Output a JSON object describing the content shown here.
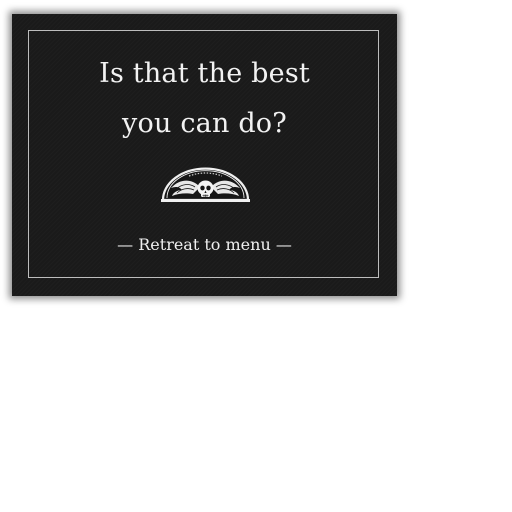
{
  "dialog": {
    "message_line1": "Is that the best",
    "message_line2": "you can do?",
    "emblem": "winged-skull-icon",
    "menu_link": "— Retreat to menu —"
  },
  "colors": {
    "panel": "#1a1a1a",
    "text": "#f2f2f2",
    "frame_line": "#bdbdbd",
    "page_background": "#ffffff"
  }
}
